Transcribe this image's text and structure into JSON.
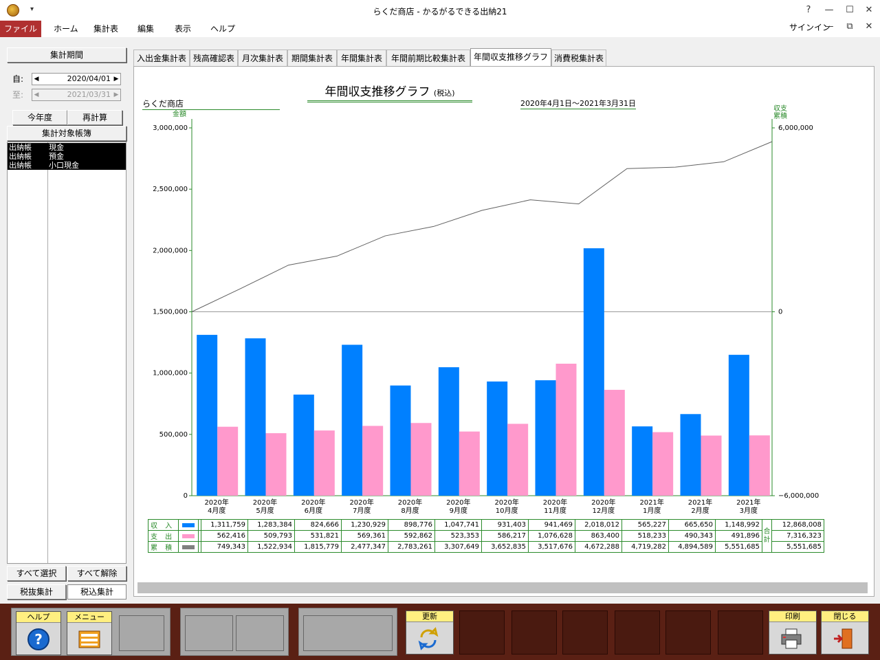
{
  "window": {
    "title": "らくだ商店 - かるがるできる出納21",
    "quick_access": "▾",
    "help": "?",
    "minimize": "—",
    "maximize": "☐",
    "close": "✕"
  },
  "menu": {
    "file": "ファイル",
    "home": "ホーム",
    "report": "集計表",
    "edit": "編集",
    "view": "表示",
    "help": "ヘルプ",
    "signin": "サインイン",
    "ribbon_min": "—",
    "ribbon_restore": "⧉",
    "ribbon_close": "✕"
  },
  "left": {
    "period_button": "集計期間",
    "from_label": "自:",
    "from_value": "2020/04/01",
    "to_label": "至:",
    "to_value": "2021/03/31",
    "this_year": "今年度",
    "recalc": "再計算",
    "ledgers_button": "集計対象帳簿",
    "ledgers": [
      {
        "type": "出納帳",
        "name": "現金"
      },
      {
        "type": "出納帳",
        "name": "預金"
      },
      {
        "type": "出納帳",
        "name": "小口現金"
      }
    ],
    "select_all": "すべて選択",
    "deselect_all": "すべて解除",
    "tax_excluded": "税抜集計",
    "tax_included": "税込集計"
  },
  "tabs": [
    "入出金集計表",
    "残高確認表",
    "月次集計表",
    "期間集計表",
    "年間集計表",
    "年間前期比較集計表",
    "年間収支推移グラフ",
    "消費税集計表"
  ],
  "active_tab": 6,
  "report": {
    "shop": "らくだ商店",
    "title": "年間収支推移グラフ",
    "title_suffix": "(税込)",
    "period": "2020年4月1日～2021年3月31日",
    "left_axis_label": "金額",
    "right_axis_label_1": "収支",
    "right_axis_label_2": "累積",
    "sum_label_1": "合",
    "sum_label_2": "計"
  },
  "chart_data": {
    "type": "bar",
    "categories": [
      "2020年\n4月度",
      "2020年\n5月度",
      "2020年\n6月度",
      "2020年\n7月度",
      "2020年\n8月度",
      "2020年\n9月度",
      "2020年\n10月度",
      "2020年\n11月度",
      "2020年\n12月度",
      "2021年\n1月度",
      "2021年\n2月度",
      "2021年\n3月度"
    ],
    "series": [
      {
        "name": "収入",
        "kind": "bar",
        "color": "#0080ff",
        "values": [
          1311759,
          1283384,
          824666,
          1230929,
          898776,
          1047741,
          931403,
          941469,
          2018012,
          565227,
          665650,
          1148992
        ],
        "labels": [
          "1,311,759",
          "1,283,384",
          "824,666",
          "1,230,929",
          "898,776",
          "1,047,741",
          "931,403",
          "941,469",
          "2,018,012",
          "565,227",
          "665,650",
          "1,148,992"
        ],
        "total": "12,868,008"
      },
      {
        "name": "支出",
        "kind": "bar",
        "color": "#ff99cc",
        "values": [
          562416,
          509793,
          531821,
          569361,
          592862,
          523353,
          586217,
          1076628,
          863400,
          518233,
          490343,
          491896
        ],
        "labels": [
          "562,416",
          "509,793",
          "531,821",
          "569,361",
          "592,862",
          "523,353",
          "586,217",
          "1,076,628",
          "863,400",
          "518,233",
          "490,343",
          "491,896"
        ],
        "total": "7,316,323"
      },
      {
        "name": "累積",
        "kind": "line",
        "color": "#808080",
        "values": [
          749343,
          1522934,
          1815779,
          2477347,
          2783261,
          3307649,
          3652835,
          3517676,
          4672288,
          4719282,
          4894589,
          5551685
        ],
        "labels": [
          "749,343",
          "1,522,934",
          "1,815,779",
          "2,477,347",
          "2,783,261",
          "3,307,649",
          "3,652,835",
          "3,517,676",
          "4,672,288",
          "4,719,282",
          "4,894,589",
          "5,551,685"
        ],
        "total": "5,551,685"
      }
    ],
    "left_axis": {
      "ylim": [
        0,
        3000000
      ],
      "ticks": [
        "0",
        "500,000",
        "1,000,000",
        "1,500,000",
        "2,000,000",
        "2,500,000",
        "3,000,000"
      ]
    },
    "right_axis": {
      "ylim": [
        -6000000,
        6000000
      ],
      "ticks": [
        "−6,000,000",
        "0",
        "6,000,000"
      ]
    },
    "grid": false,
    "legend": "table-bottom"
  },
  "toolbar": {
    "help": "ヘルプ",
    "menu": "メニュー",
    "refresh": "更新",
    "print": "印刷",
    "close": "閉じる"
  }
}
